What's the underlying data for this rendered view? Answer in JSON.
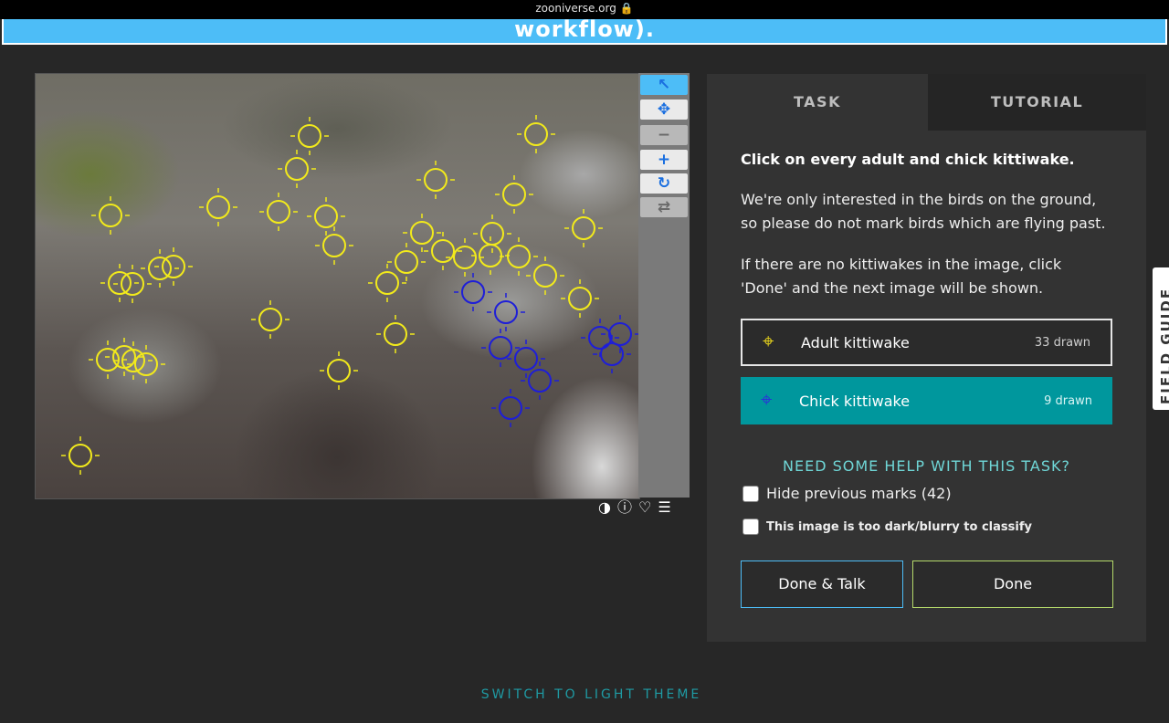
{
  "browser": {
    "url": "zooniverse.org 🔒"
  },
  "banner": {
    "text": "workflow)."
  },
  "viewer": {
    "tools": [
      {
        "name": "select",
        "glyph": "↖"
      },
      {
        "name": "pan",
        "glyph": "✥"
      },
      {
        "name": "zoom-out",
        "glyph": "−"
      },
      {
        "name": "zoom-in",
        "glyph": "+"
      },
      {
        "name": "rotate",
        "glyph": "↻"
      },
      {
        "name": "reset",
        "glyph": "⇄"
      }
    ],
    "meta_icons": [
      "◑",
      "ⓘ",
      "♡",
      "☰"
    ],
    "adult_color": "#f2ea1b",
    "chick_color": "#1e1ed8"
  },
  "task_panel": {
    "tab_task": "TASK",
    "tab_tutorial": "TUTORIAL",
    "question": "Click on every adult and chick kittiwake.",
    "instruction_1a": "We're only interested in the birds on the ground,",
    "instruction_1b": "so please do not mark birds which are flying past.",
    "instruction_2a": "If there are no kittiwakes in the image, click",
    "instruction_2b": "'Done' and the next image will be shown.",
    "tools": {
      "adult": {
        "label": "Adult kittiwake",
        "count": "33 drawn",
        "color": "#e8d41c"
      },
      "chick": {
        "label": "Chick kittiwake",
        "count": "9 drawn",
        "color": "#2a32d8"
      }
    },
    "help_link": "NEED SOME HELP WITH THIS TASK?",
    "hide_marks": "Hide previous marks (42)",
    "too_dark": "This image is too dark/blurry to classify",
    "done_talk": "Done & Talk",
    "done": "Done"
  },
  "field_guide": "FIELD GUIDE",
  "footer": {
    "theme_switch": "SWITCH TO LIGHT THEME"
  }
}
